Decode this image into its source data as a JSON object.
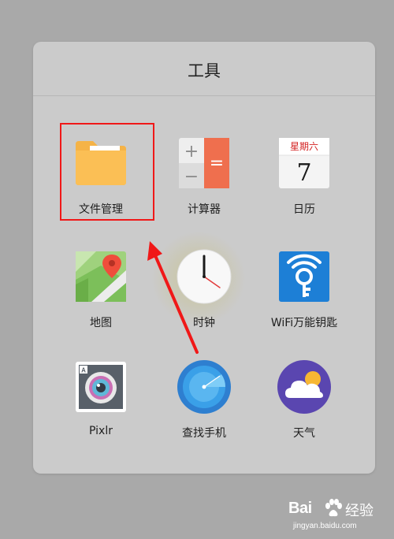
{
  "folder": {
    "title": "工具"
  },
  "apps": [
    {
      "label": "文件管理",
      "icon": "folder-icon"
    },
    {
      "label": "计算器",
      "icon": "calculator-icon",
      "glyph_plus": "+",
      "glyph_minus": "−",
      "glyph_equals": "="
    },
    {
      "label": "日历",
      "icon": "calendar-icon",
      "weekday": "星期六",
      "day": "7"
    },
    {
      "label": "地图",
      "icon": "map-icon"
    },
    {
      "label": "时钟",
      "icon": "clock-icon"
    },
    {
      "label": "WiFi万能钥匙",
      "icon": "wifi-key-icon"
    },
    {
      "label": "Pixlr",
      "icon": "camera-lens-icon"
    },
    {
      "label": "查找手机",
      "icon": "radar-icon"
    },
    {
      "label": "天气",
      "icon": "weather-icon"
    }
  ],
  "annotation": {
    "highlight_color": "#f01818"
  },
  "watermark": {
    "brand": "Bai",
    "brand_cn": "经验",
    "url": "jingyan.baidu.com"
  }
}
